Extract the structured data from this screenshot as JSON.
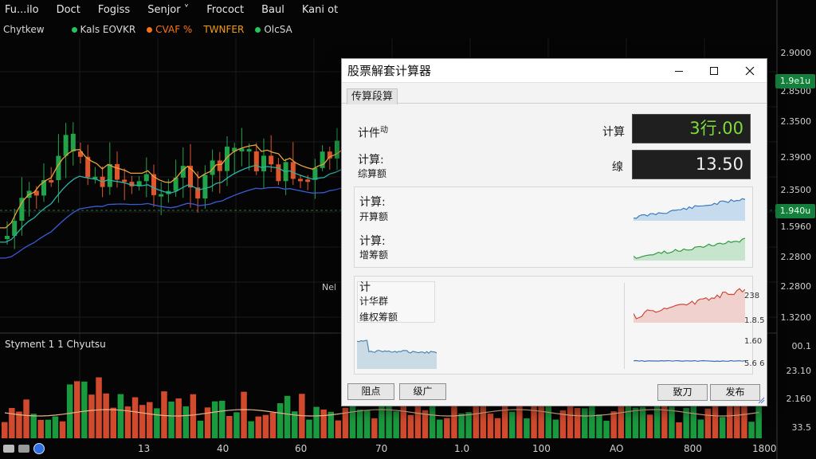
{
  "menubar": [
    "Fu...ilo",
    "Doct",
    "Fogiss",
    "Senjor ˅",
    "Frococt",
    "Baul",
    "Kani ot"
  ],
  "legend": {
    "title": "Chytkew",
    "items": [
      {
        "label": "Kals EOVKR",
        "color": "#22c55e"
      },
      {
        "label": "CVAF %",
        "color": "#f97316"
      },
      {
        "label": "TWNFER",
        "color": "#f59e0b"
      },
      {
        "label": "OlcSA",
        "color": "#22c55e"
      }
    ]
  },
  "price_axis": [
    "2.9000",
    "2.8500",
    "2.3500",
    "2.3900",
    "2.3500",
    "1.5960",
    "2.2800",
    "2.2800",
    "1.3200",
    "00.1",
    "23.10",
    "2.160",
    "33.5"
  ],
  "price_tags": {
    "top": "1.9e1u",
    "mid": "1.940u"
  },
  "x_axis": [
    "13",
    "40",
    "60",
    "70",
    "1.0",
    "100",
    "AO",
    "800",
    "1800"
  ],
  "volume_title": "Styment  1 1  Chyutsu",
  "chart_note": "Nel",
  "colors": {
    "up": "#22a34a",
    "down": "#e0562c",
    "volume_up": "#1a9a3f",
    "volume_down": "#d24a2e"
  },
  "dialog": {
    "title": "股票解套计算器",
    "tab": "传算段算",
    "section1": {
      "label1": "计件",
      "label1_sup": "动",
      "label2_line1": "计算:",
      "label2_line2": "综算额",
      "field1_label": "计算",
      "field1_value": "3行.00",
      "field1_color": "#7ddc3c",
      "field2_label": "缐",
      "field2_value": "13.50",
      "field2_color": "#f0f0f0"
    },
    "section2": {
      "row1_line1": "计算:",
      "row1_line2": "开算额",
      "row2_line1": "计算:",
      "row2_line2": "增筹额"
    },
    "section3": {
      "line1": "计",
      "line2": "计华群",
      "line3": "维权筹额",
      "scale": [
        "238",
        "1.8.5",
        "1.60",
        "5.6 6"
      ]
    },
    "buttons": {
      "b1": "阻点",
      "b2": "级广",
      "b3": "致刀",
      "b4": "发布"
    }
  }
}
